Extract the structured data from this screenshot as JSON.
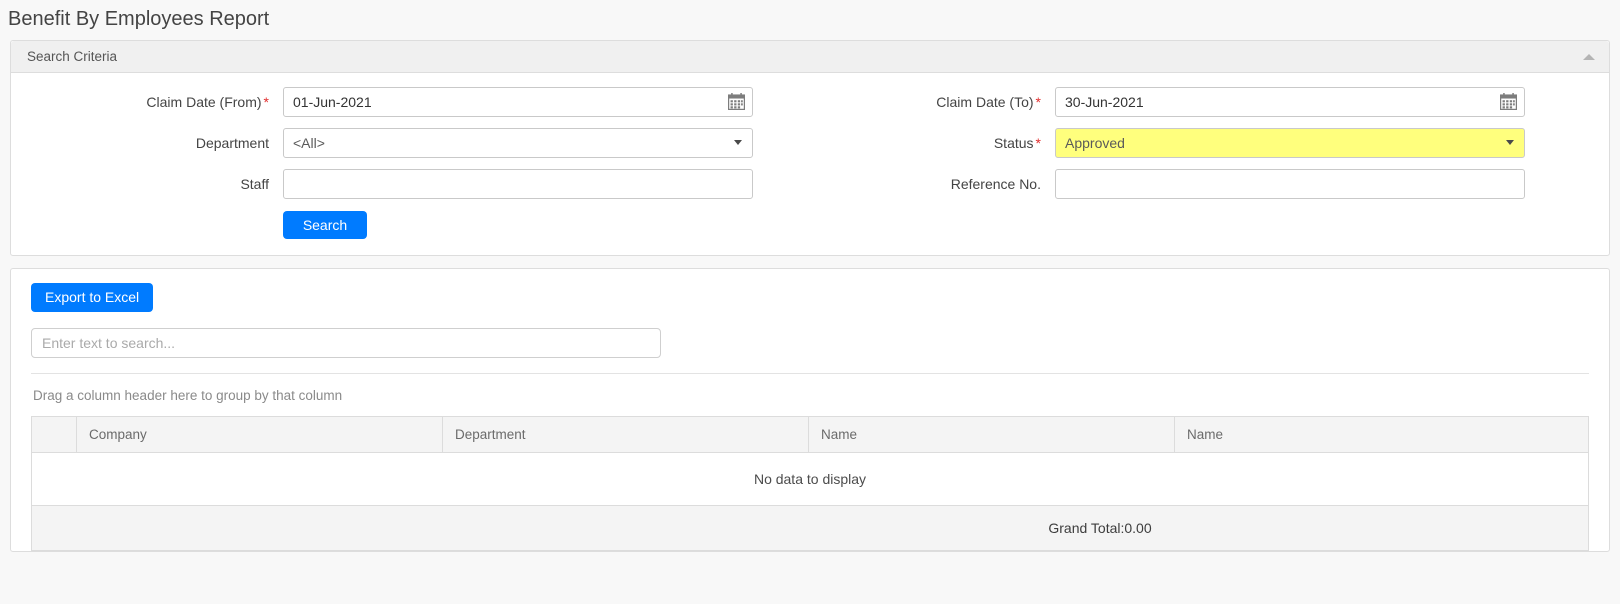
{
  "page": {
    "title": "Benefit By Employees Report"
  },
  "search_panel": {
    "header": "Search Criteria",
    "collapse_icon": "triangle-up-icon",
    "fields": {
      "claim_date_from": {
        "label": "Claim Date (From)",
        "required": "*",
        "value": "01-Jun-2021",
        "icon": "calendar-icon"
      },
      "claim_date_to": {
        "label": "Claim Date (To)",
        "required": "*",
        "value": "30-Jun-2021",
        "icon": "calendar-icon"
      },
      "department": {
        "label": "Department",
        "value": "<All>",
        "icon": "chevron-down-icon"
      },
      "status": {
        "label": "Status",
        "required": "*",
        "value": "Approved",
        "highlight_color": "#ffff7d",
        "icon": "chevron-down-icon"
      },
      "staff": {
        "label": "Staff",
        "value": "",
        "placeholder": ""
      },
      "reference_no": {
        "label": "Reference No.",
        "value": "",
        "placeholder": ""
      }
    },
    "search_button": "Search"
  },
  "results_panel": {
    "export_button": "Export to Excel",
    "search_input": {
      "value": "",
      "placeholder": "Enter text to search..."
    },
    "group_hint": "Drag a column header here to group by that column",
    "grid": {
      "columns": [
        "",
        "Company",
        "Department",
        "Name",
        "Name"
      ],
      "rows": [],
      "empty_message": "No data to display",
      "grand_total": "Grand Total:0.00"
    }
  },
  "colors": {
    "primary": "#007bff",
    "required": "#e12d2d",
    "highlight": "#ffff7d",
    "page_bg": "#f8f8f8"
  }
}
